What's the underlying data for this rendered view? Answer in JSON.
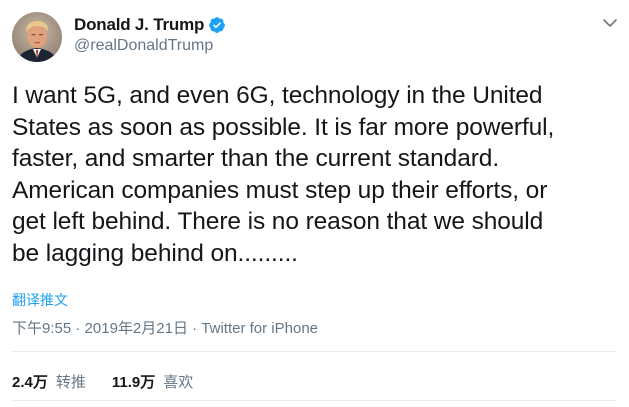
{
  "tweet": {
    "author": {
      "display_name": "Donald J. Trump",
      "handle": "@realDonaldTrump",
      "verified": true,
      "avatar_icon": "profile-photo",
      "verified_icon": "verified-badge-icon"
    },
    "menu_icon": "chevron-down-icon",
    "text_lines": [
      "I want 5G, and even 6G, technology in the United",
      "States as soon as possible. It is far more powerful,",
      "faster, and smarter than the current standard.",
      "American companies must step up their efforts, or",
      "get left behind. There is no reason that we should",
      "be lagging behind on........."
    ],
    "translate_label": "翻译推文",
    "meta": {
      "time": "下午9:55",
      "separator": "·",
      "date": "2019年2月21日",
      "source": "Twitter for iPhone"
    },
    "stats": {
      "retweets_count": "2.4万",
      "retweets_label": "转推",
      "likes_count": "11.9万",
      "likes_label": "喜欢"
    }
  },
  "colors": {
    "text": "#14171a",
    "secondary": "#657786",
    "accent": "#1da1f2",
    "divider": "#e6ecf0"
  }
}
